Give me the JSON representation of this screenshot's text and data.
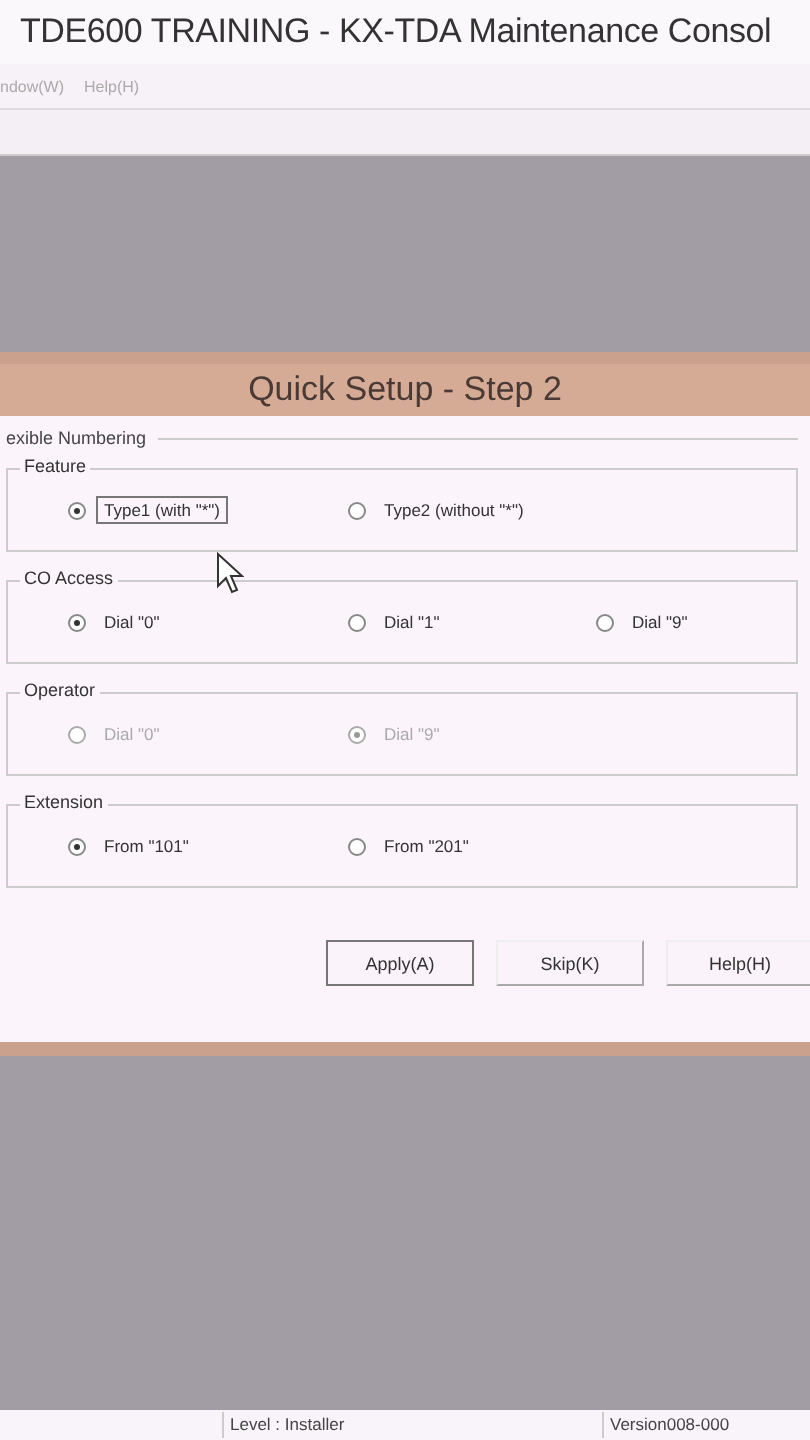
{
  "window": {
    "title": "TDE600 TRAINING - KX-TDA Maintenance Consol"
  },
  "menu": [
    "ndow(W)",
    "Help(H)"
  ],
  "dialog": {
    "title": "Quick Setup - Step 2",
    "section": "exible Numbering",
    "groups": [
      {
        "label": "Feature",
        "disabled": false,
        "options": [
          {
            "label": "Type1 (with \"*\")",
            "selected": true,
            "focused": true
          },
          {
            "label": "Type2 (without \"*\")",
            "selected": false,
            "focused": false
          }
        ]
      },
      {
        "label": "CO Access",
        "disabled": false,
        "options": [
          {
            "label": "Dial \"0\"",
            "selected": true,
            "focused": false
          },
          {
            "label": "Dial \"1\"",
            "selected": false,
            "focused": false
          },
          {
            "label": "Dial \"9\"",
            "selected": false,
            "focused": false
          }
        ]
      },
      {
        "label": "Operator",
        "disabled": true,
        "options": [
          {
            "label": "Dial \"0\"",
            "selected": false,
            "focused": false
          },
          {
            "label": "Dial \"9\"",
            "selected": true,
            "focused": false
          }
        ]
      },
      {
        "label": "Extension",
        "disabled": false,
        "options": [
          {
            "label": "From \"101\"",
            "selected": true,
            "focused": false
          },
          {
            "label": "From \"201\"",
            "selected": false,
            "focused": false
          }
        ]
      }
    ],
    "buttons": [
      {
        "label": "Apply(A)",
        "default": true
      },
      {
        "label": "Skip(K)",
        "default": false
      },
      {
        "label": "Help(H)",
        "default": false
      }
    ]
  },
  "status_bar": [
    "Level : Installer",
    "Version008-000"
  ]
}
